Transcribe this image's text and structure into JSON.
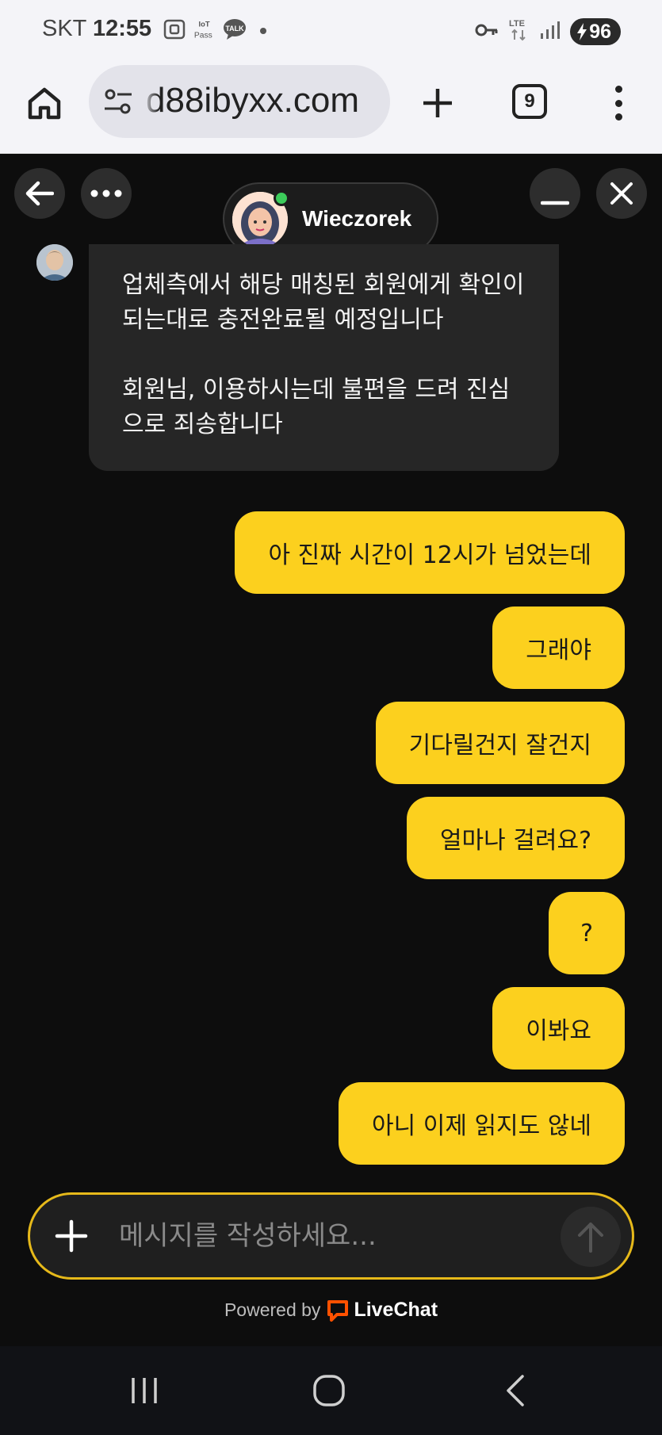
{
  "status_bar": {
    "carrier": "SKT",
    "time": "12:55",
    "icons_left": [
      "screen-capture-icon",
      "iot-pass-icon",
      "talk-icon"
    ],
    "iot_label_top": "IoT",
    "iot_label_bottom": "Pass",
    "talk_label": "TALK",
    "network": "LTE",
    "battery": "96"
  },
  "browser": {
    "url": "d88ibyxx.com",
    "tab_count": "9"
  },
  "chat": {
    "agent_name": "Wieczorek",
    "agent_status_color": "#3ccb5a",
    "agent_message": {
      "line1": "업체측에서 해당 매칭된 회원에게 확인이 되는대로 충전완료될 예정입니다",
      "line2": "회원님, 이용하시는데 불편을 드려 진심으로 죄송합니다"
    },
    "user_messages": [
      "아 진짜 시간이 12시가 넘었는데",
      "그래야",
      "기다릴건지 잘건지",
      "얼마나 걸려요?",
      "?",
      "이봐요",
      "아니 이제 읽지도 않네"
    ],
    "bubble_color": "#fcd01e"
  },
  "composer": {
    "placeholder": "메시지를 작성하세요..."
  },
  "footer": {
    "powered_by": "Powered by",
    "brand": "LiveChat",
    "brand_color": "#ff5100"
  }
}
